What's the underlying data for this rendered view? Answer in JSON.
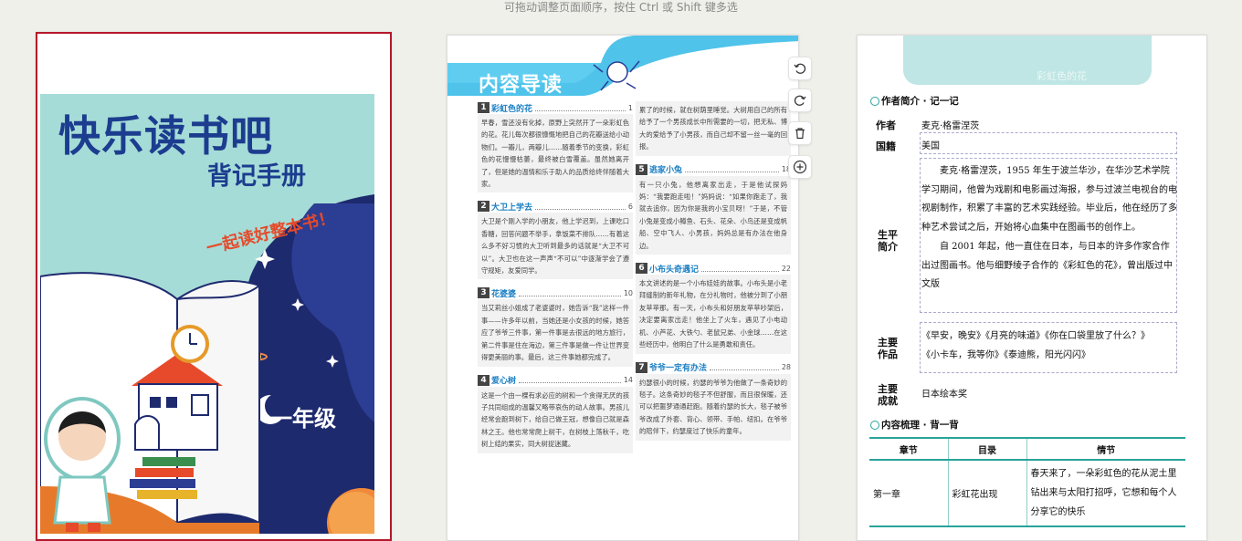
{
  "hint": "可拖动调整页面顺序，按住 Ctrl 或 Shift 键多选",
  "colors": {
    "selected_border": "#b5182b",
    "accent": "#28a39a",
    "toc_blue": "#1b7fc4"
  },
  "cover": {
    "title": "快乐读书吧",
    "subtitle": "背记手册",
    "slogan": "一起读好整本书！",
    "grade": "一年级"
  },
  "toc": {
    "title": "内容导读",
    "items": [
      {
        "num": "1",
        "title": "彩虹色的花",
        "page": "1",
        "text": "早春，雪还没有化掉，原野上突然开了一朵彩虹色的花。花儿每次都很慷慨地把自己的花瓣送给小动物们。一瓣儿，两瓣儿……随着季节的变换，彩虹色的花慢慢枯萎，最终被白雪覆盖。虽然她离开了，但是她的温情和乐于助人的品质给终伴随着大家。"
      },
      {
        "num": "2",
        "title": "大卫上学去",
        "page": "6",
        "text": "大卫是个刚入学的小朋友，他上学迟到，上课吃口香糖，回答问题不举手，拿饭菜不排队……有着这么多不好习惯的大卫听到最多的话就是“大卫不可以”。大卫也在这一声声“不可以”中逐渐学会了遵守规矩，友爱同学。"
      },
      {
        "num": "3",
        "title": "花婆婆",
        "page": "10",
        "text": "当艾莉丝小姐成了老婆婆时，她告诉“我”这样一件事——许多年以前，当她还是小女孩的时候，她答应了爷爷三件事，第一件事是去很远的地方旅行，第二件事是住在海边，第三件事是做一件让世界变得更美丽的事。最后，这三件事她都完成了。"
      },
      {
        "num": "4",
        "title": "爱心树",
        "page": "14",
        "text": "这是一个由一棵有求必应的树和一个贪得无厌的孩子共同组成的温馨又略带哀伤的动人故事。男孩儿经常会跑到树下，给自己做王冠，想像自己就是森林之王。他也常常爬上树干，在树枝上荡秋千，吃树上结的果实，同大树捉迷藏。"
      },
      {
        "num": "",
        "title": "",
        "page": "",
        "text": "累了的时候，就在树荫里睡觉。大树用自己的所有给予了一个男孩成长中所需要的一切，把无私、博大的爱给予了小男孩，而自己却不留一丝一毫的回报。"
      },
      {
        "num": "5",
        "title": "逃家小兔",
        "page": "18",
        "text": "有一只小兔，他想离家出走，于是他试探妈妈：“我要跑走啦！”妈妈说：“如果你跑走了，我就去追你，因为你是我的小宝贝呀！”于是，不管小兔是变成小鳟鱼、石头、花朵、小鸟还是变成帆船、空中飞人、小男孩，妈妈总是有办法在他身边。"
      },
      {
        "num": "6",
        "title": "小布头奇遇记",
        "page": "22",
        "text": "本文讲述的是一个小布娃娃的故事。小布头是小老拜缝制的新年礼物，在分礼物时，他被分到了小朋友苹苹那。有一天，小布头和好朋友苹苹吵架后，决定要离家出走！他坐上了火车，遇见了小电动机、小芦花、大铁勺、老鼠兄弟、小金球……在这些经历中，他明白了什么是勇敢和责任。"
      },
      {
        "num": "7",
        "title": "爷爷一定有办法",
        "page": "28",
        "text": "约瑟很小的时候，约瑟的爷爷为他做了一条奇妙的毯子。这条奇妙的毯子不但舒服，而且很保暖，还可以把噩梦通通赶跑。随着约瑟的长大，毯子被爷爷改成了外套、背心、领带、手帕、纽扣。在爷爷的陪伴下，约瑟度过了快乐的童年。"
      }
    ]
  },
  "tools": {
    "rotate_left": "rotate-left",
    "rotate_right": "rotate-right",
    "delete": "delete",
    "add": "add"
  },
  "sheet": {
    "header_title": "彩虹色的花",
    "section1": "作者简介 · 记一记",
    "author_label": "作者",
    "author": "麦克·格雷涅茨",
    "country_label": "国籍",
    "country": "美国",
    "bio_label": "生平简介",
    "bio_1": "麦克·格雷涅茨，1955 年生于波兰华沙，在华沙艺术学院学习期间，他曾为戏剧和电影画过海报，参与过波兰电视台的电视剧制作，积累了丰富的艺术实践经验。毕业后，他在经历了多种艺术尝试之后，开始将心血集中在图画书的创作上。",
    "bio_2": "自 2001 年起，他一直住在日本，与日本的许多作家合作出过图画书。他与细野绫子合作的《彩虹色的花》，曾出版过中文版",
    "works_label": "主要作品",
    "works_1": "《早安，晚安》《月亮的味道》《你在口袋里放了什么？》",
    "works_2": "《小卡车，我等你》《泰迪熊，阳光闪闪》",
    "honor_label": "主要成就",
    "honor": "日本绘本奖",
    "section2": "内容梳理 · 背一背",
    "table_headers": [
      "章节",
      "目录",
      "情节"
    ],
    "table_row": [
      "第一章",
      "彩虹花出现",
      "春天来了，一朵彩虹色的花从泥土里钻出来与太阳打招呼，它想和每个人分享它的快乐"
    ]
  }
}
